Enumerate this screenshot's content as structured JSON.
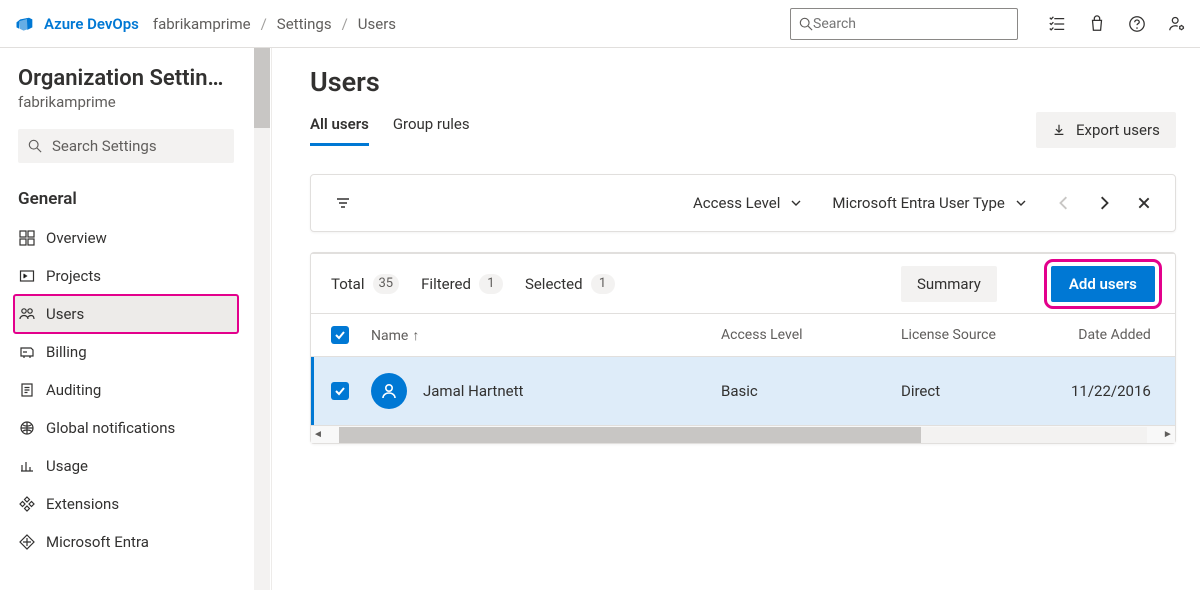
{
  "header": {
    "brand": "Azure DevOps",
    "crumbs": [
      "fabrikamprime",
      "Settings",
      "Users"
    ],
    "search_placeholder": "Search"
  },
  "sidebar": {
    "title": "Organization Settin…",
    "subtitle": "fabrikamprime",
    "search_placeholder": "Search Settings",
    "section": "General",
    "items": [
      {
        "label": "Overview",
        "selected": false
      },
      {
        "label": "Projects",
        "selected": false
      },
      {
        "label": "Users",
        "selected": true
      },
      {
        "label": "Billing",
        "selected": false
      },
      {
        "label": "Auditing",
        "selected": false
      },
      {
        "label": "Global notifications",
        "selected": false
      },
      {
        "label": "Usage",
        "selected": false
      },
      {
        "label": "Extensions",
        "selected": false
      },
      {
        "label": "Microsoft Entra",
        "selected": false
      }
    ]
  },
  "main": {
    "title": "Users",
    "tabs": [
      {
        "label": "All users",
        "active": true
      },
      {
        "label": "Group rules",
        "active": false
      }
    ],
    "export_label": "Export users",
    "filters": {
      "access_level": "Access Level",
      "aad_type": "Microsoft Entra User Type"
    },
    "stats": {
      "total_label": "Total",
      "total": "35",
      "filtered_label": "Filtered",
      "filtered": "1",
      "selected_label": "Selected",
      "selected": "1"
    },
    "summary_label": "Summary",
    "add_label": "Add users",
    "columns": {
      "name": "Name",
      "access": "Access Level",
      "source": "License Source",
      "date": "Date Added"
    },
    "rows": [
      {
        "name": "Jamal Hartnett",
        "access": "Basic",
        "source": "Direct",
        "date": "11/22/2016"
      }
    ]
  }
}
